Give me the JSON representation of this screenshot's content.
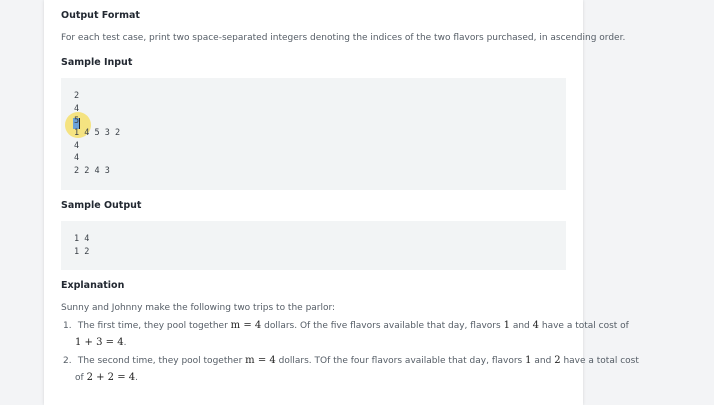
{
  "output_format": {
    "heading": "Output Format",
    "text": "For each test case, print two space-separated integers denoting the indices of the two flavors purchased, in ascending order."
  },
  "sample_input": {
    "heading": "Sample Input",
    "lines": [
      "2",
      "4",
      "5",
      "1 4 5 3 2",
      "4",
      "4",
      "2 2 4 3"
    ]
  },
  "sample_output": {
    "heading": "Sample Output",
    "lines": [
      "1 4",
      "1 2"
    ]
  },
  "explanation": {
    "heading": "Explanation",
    "intro": "Sunny and Johnny make the following two trips to the parlor:",
    "items": [
      {
        "number": "1.",
        "part1": "The first time, they pool together",
        "math1": "m = 4",
        "part2": "dollars. Of the five flavors available that day, flavors",
        "math2": "1",
        "part3": "and",
        "math3": "4",
        "part4": "have a total cost of",
        "math4": "1 + 3 = 4",
        "end": "."
      },
      {
        "number": "2.",
        "part1": "The second time, they pool together",
        "math1": "m = 4",
        "part2": "dollars. TOf the four flavors available that day, flavors",
        "math2": "1",
        "part3": "and",
        "math3": "2",
        "part4": "have a total cost",
        "line2_prefix": "of",
        "math4": "2 + 2 = 4",
        "end": "."
      }
    ]
  }
}
